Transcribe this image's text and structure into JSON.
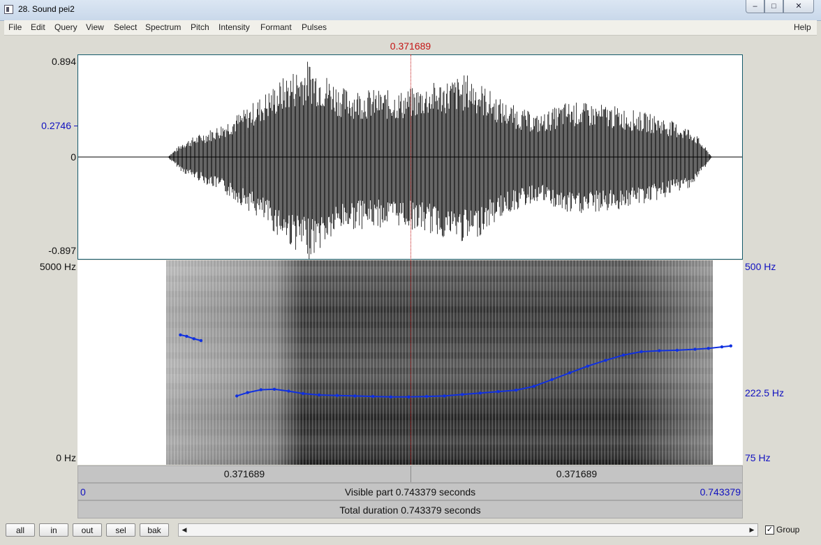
{
  "window": {
    "title": "28. Sound pei2",
    "min_glyph": "–",
    "max_glyph": "□",
    "close_glyph": "✕"
  },
  "menu": {
    "items": [
      "File",
      "Edit",
      "Query",
      "View",
      "Select",
      "Spectrum",
      "Pitch",
      "Intensity",
      "Formant",
      "Pulses"
    ],
    "help": "Help"
  },
  "cursor": {
    "time_label": "0.371689",
    "time": 0.371689
  },
  "waveform": {
    "max_label": "0.894",
    "mid_label": "0.2746",
    "zero_label": "0",
    "min_label": "-0.897"
  },
  "spectrogram": {
    "top_label": "5000 Hz",
    "bottom_label": "0 Hz"
  },
  "pitch": {
    "top_label": "500 Hz",
    "mid_label": "222.5 Hz",
    "bottom_label": "75 Hz"
  },
  "bars": {
    "left_time": "0.371689",
    "right_time": "0.371689",
    "visible_start": "0",
    "visible_text": "Visible part 0.743379 seconds",
    "visible_end": "0.743379",
    "total_text": "Total duration 0.743379 seconds"
  },
  "toolbar": {
    "all": "all",
    "in": "in",
    "out": "out",
    "sel": "sel",
    "bak": "bak",
    "group_label": "Group",
    "group_checked": true,
    "left_arrow": "◀",
    "right_arrow": "▶",
    "check_glyph": "✓"
  },
  "colors": {
    "cursor": "#c41414",
    "pitch": "#1030e0",
    "axis_blue": "#1010c0"
  },
  "pitch_contour": {
    "segments": [
      {
        "t": [
          0.115,
          0.122,
          0.13,
          0.138
        ],
        "hz": [
          345,
          342,
          337,
          333
        ]
      },
      {
        "t": [
          0.178,
          0.19,
          0.205,
          0.22,
          0.236,
          0.252,
          0.27,
          0.29,
          0.31,
          0.33,
          0.35,
          0.37,
          0.39,
          0.41,
          0.43,
          0.45,
          0.47,
          0.49,
          0.51,
          0.53,
          0.55,
          0.57,
          0.59,
          0.61,
          0.63,
          0.65,
          0.67,
          0.69,
          0.705,
          0.72,
          0.73
        ],
        "hz": [
          218,
          225,
          231,
          232,
          228,
          223,
          220,
          219,
          218,
          217,
          216,
          216,
          217,
          218,
          221,
          224,
          227,
          230,
          238,
          252,
          266,
          280,
          292,
          303,
          310,
          312,
          313,
          315,
          317,
          320,
          322
        ]
      }
    ],
    "tmax": 0.743379,
    "hz_min": 75,
    "hz_max": 500
  }
}
